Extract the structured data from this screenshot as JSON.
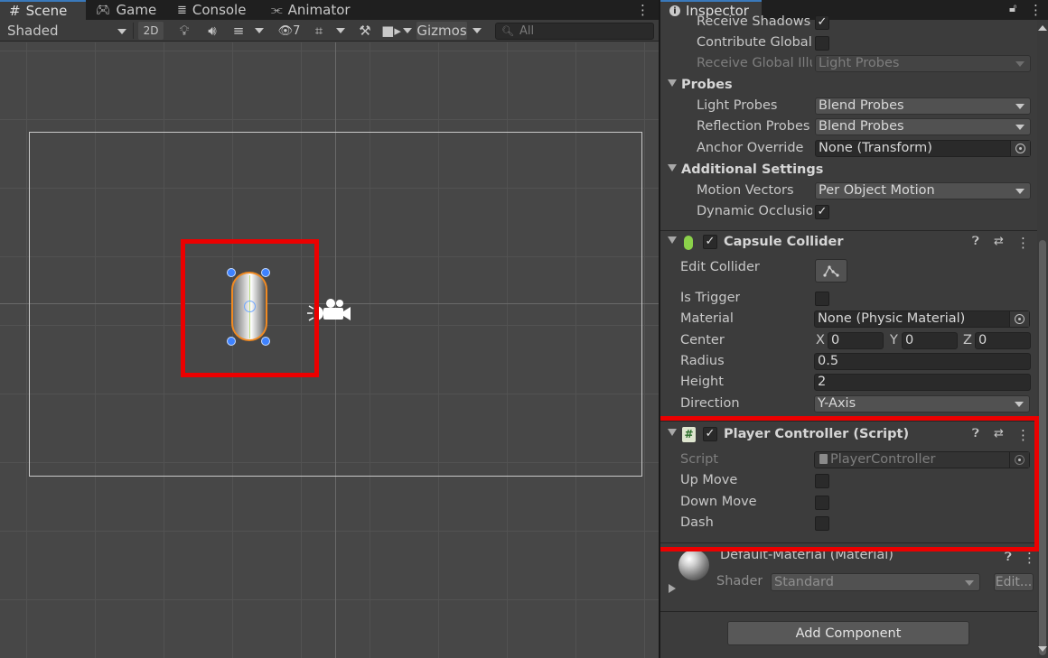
{
  "scene_tabs": [
    {
      "label": "Scene",
      "icon": "hash-icon"
    },
    {
      "label": "Game",
      "icon": "gamepad-icon"
    },
    {
      "label": "Console",
      "icon": "console-icon"
    },
    {
      "label": "Animator",
      "icon": "animator-icon"
    }
  ],
  "toolbar": {
    "shading_mode": "Shaded",
    "mode_2d": "2D",
    "hidden_count": "7",
    "gizmos": "Gizmos",
    "search_placeholder": "All"
  },
  "inspector": {
    "tab_label": "Inspector",
    "mesh_renderer": {
      "receive_shadows_label": "Receive Shadows",
      "receive_shadows": true,
      "contribute_gi_label": "Contribute Global I",
      "contribute_gi": false,
      "receive_gi_label": "Receive Global Illu",
      "receive_gi_value": "Light Probes",
      "probes_header": "Probes",
      "light_probes_label": "Light Probes",
      "light_probes_value": "Blend Probes",
      "reflection_probes_label": "Reflection Probes",
      "reflection_probes_value": "Blend Probes",
      "anchor_override_label": "Anchor Override",
      "anchor_override_value": "None (Transform)",
      "additional_header": "Additional Settings",
      "motion_vectors_label": "Motion Vectors",
      "motion_vectors_value": "Per Object Motion",
      "dynamic_occlusion_label": "Dynamic Occlusior",
      "dynamic_occlusion": true
    },
    "capsule_collider": {
      "title": "Capsule Collider",
      "enabled": true,
      "edit_collider_label": "Edit Collider",
      "is_trigger_label": "Is Trigger",
      "is_trigger": false,
      "material_label": "Material",
      "material_value": "None (Physic Material)",
      "center_label": "Center",
      "center": {
        "x_label": "X",
        "x": "0",
        "y_label": "Y",
        "y": "0",
        "z_label": "Z",
        "z": "0"
      },
      "radius_label": "Radius",
      "radius": "0.5",
      "height_label": "Height",
      "height": "2",
      "direction_label": "Direction",
      "direction_value": "Y-Axis"
    },
    "player_controller": {
      "title": "Player Controller (Script)",
      "enabled": true,
      "script_label": "Script",
      "script_value": "PlayerController",
      "up_move_label": "Up Move",
      "up_move": false,
      "down_move_label": "Down Move",
      "down_move": false,
      "dash_label": "Dash",
      "dash": false
    },
    "material": {
      "title": "Default-Material (Material)",
      "shader_label": "Shader",
      "shader_value": "Standard",
      "edit_label": "Edit..."
    },
    "add_component": "Add Component"
  },
  "colors": {
    "highlight": "#ec0000",
    "selection_outline": "#f08a23",
    "handle": "#3e82ff"
  }
}
